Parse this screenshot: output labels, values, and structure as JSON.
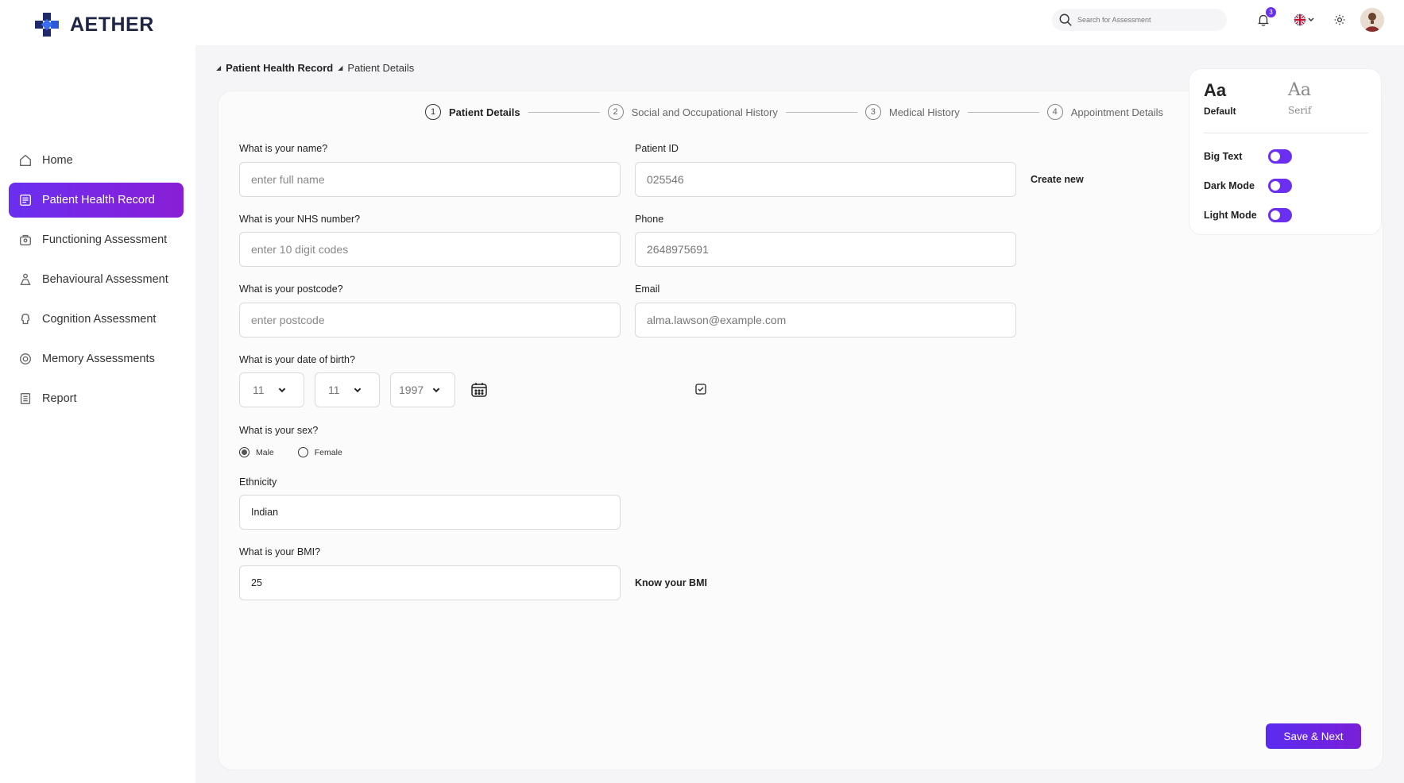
{
  "app": {
    "brand": "AETHER"
  },
  "sidebar": {
    "items": [
      {
        "label": "Home",
        "icon": "home-icon"
      },
      {
        "label": "Patient Health Record",
        "icon": "record-icon",
        "active": true
      },
      {
        "label": "Functioning Assessment",
        "icon": "functioning-icon"
      },
      {
        "label": "Behavioural Assessment",
        "icon": "behaviour-icon"
      },
      {
        "label": "Cognition Assessment",
        "icon": "brain-icon"
      },
      {
        "label": "Memory Assessments",
        "icon": "memory-icon"
      },
      {
        "label": "Report",
        "icon": "report-icon"
      }
    ]
  },
  "topbar": {
    "search_placeholder": "Search for Assessment",
    "notification_count": "3",
    "language_flag": "uk-flag-icon"
  },
  "breadcrumb": {
    "root": "Patient Health Record",
    "current": "Patient Details"
  },
  "stepper": [
    {
      "num": "1",
      "label": "Patient Details",
      "active": true
    },
    {
      "num": "2",
      "label": "Social and Occupational History"
    },
    {
      "num": "3",
      "label": "Medical History"
    },
    {
      "num": "4",
      "label": "Appointment Details"
    }
  ],
  "form": {
    "name_label": "What is your name?",
    "name_placeholder": "enter full name",
    "patient_id_label": "Patient ID",
    "patient_id_value": "025546",
    "create_new": "Create new",
    "nhs_label": "What is your NHS number?",
    "nhs_placeholder": "enter 10 digit codes",
    "phone_label": "Phone",
    "phone_value": "2648975691",
    "postcode_label": "What is your postcode?",
    "postcode_placeholder": "enter postcode",
    "email_label": "Email",
    "email_value": "alma.lawson@example.com",
    "dob_label": "What is your date of birth?",
    "dob_day": "11",
    "dob_month": "11",
    "dob_year": "1997",
    "sex_label": "What is your sex?",
    "sex_options": [
      "Male",
      "Female"
    ],
    "sex_selected": "Male",
    "ethnicity_label": "Ethnicity",
    "ethnicity_value": "Indian",
    "bmi_label": "What is your BMI?",
    "bmi_value": "25",
    "know_bmi": "Know your BMI"
  },
  "font_panel": {
    "options": [
      {
        "sample": "Aa",
        "name": "Default",
        "selected": true
      },
      {
        "sample": "Aa",
        "name": "Serif"
      }
    ],
    "toggles": [
      {
        "label": "Big Text",
        "on": true
      },
      {
        "label": "Dark Mode",
        "on": true
      },
      {
        "label": "Light Mode",
        "on": true
      }
    ]
  },
  "actions": {
    "save_next": "Save & Next"
  },
  "colors": {
    "accent": "#6a2ff0",
    "accent_end": "#8a1ed6",
    "brand_dark": "#1f2545"
  }
}
